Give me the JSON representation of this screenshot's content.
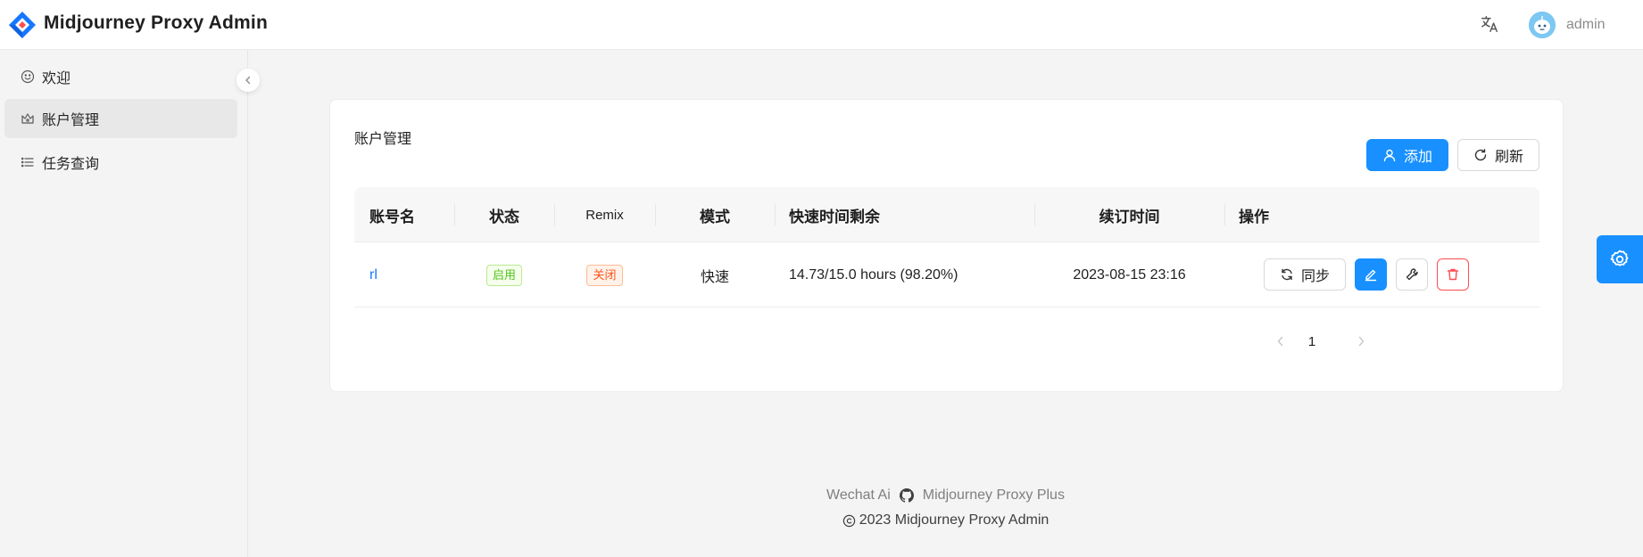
{
  "header": {
    "app_title": "Midjourney Proxy Admin",
    "username": "admin",
    "translate_icon": "translate-icon",
    "avatar_icon": "robot-avatar"
  },
  "sidebar": {
    "items": [
      {
        "label": "欢迎",
        "icon": "smile-icon",
        "active": false
      },
      {
        "label": "账户管理",
        "icon": "crown-icon",
        "active": true
      },
      {
        "label": "任务查询",
        "icon": "list-icon",
        "active": false
      }
    ],
    "collapse_icon": "chevron-left-icon"
  },
  "card": {
    "title": "账户管理",
    "add_label": "添加",
    "refresh_label": "刷新"
  },
  "table": {
    "columns": [
      "账号名",
      "状态",
      "Remix",
      "模式",
      "快速时间剩余",
      "续订时间",
      "操作"
    ],
    "rows": [
      {
        "name": "rl",
        "status": "启用",
        "remix": "关闭",
        "mode": "快速",
        "fast_time_remaining": "14.73/15.0 hours (98.20%)",
        "renew_time": "2023-08-15 23:16",
        "sync_label": "同步"
      }
    ]
  },
  "pagination": {
    "current_page": "1"
  },
  "footer": {
    "link1": "Wechat Ai",
    "link2": "Midjourney Proxy Plus",
    "copyright": "2023 Midjourney Proxy Admin"
  },
  "colors": {
    "primary": "#1890ff",
    "status_green": "#52c41a",
    "status_orange": "#fa541c",
    "danger": "#ff4d4f"
  }
}
